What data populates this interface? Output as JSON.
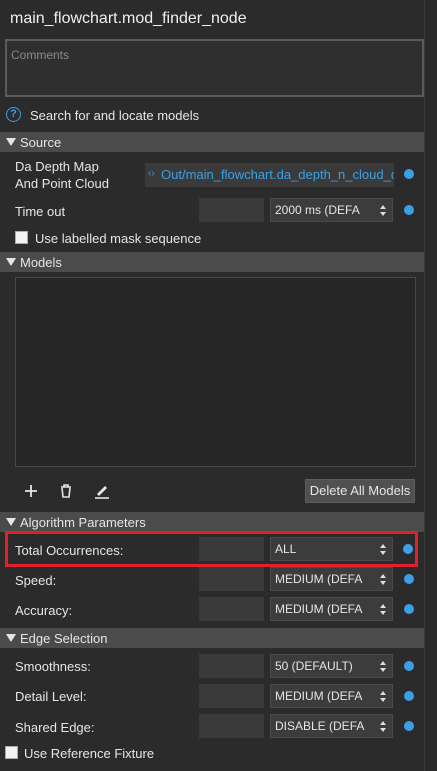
{
  "title": "main_flowchart.mod_finder_node",
  "comments_placeholder": "Comments",
  "help_text": "Search for and locate models",
  "sections": {
    "source": "Source",
    "models": "Models",
    "algorithm": "Algorithm Parameters",
    "edge": "Edge Selection"
  },
  "source": {
    "depth_label_line1": "Da Depth Map",
    "depth_label_line2": "And Point Cloud",
    "depth_value": "Out/main_flowchart.da_depth_n_cloud_co",
    "timeout_label": "Time out",
    "timeout_value": "2000 ms (DEFA",
    "mask_label": "Use labelled mask sequence"
  },
  "models": {
    "delete_all_label": "Delete All Models"
  },
  "algorithm": {
    "total_label": "Total Occurrences:",
    "total_value": "ALL",
    "speed_label": "Speed:",
    "speed_value": "MEDIUM (DEFA",
    "accuracy_label": "Accuracy:",
    "accuracy_value": "MEDIUM (DEFA"
  },
  "edge": {
    "smooth_label": "Smoothness:",
    "smooth_value": "50 (DEFAULT)",
    "detail_label": "Detail Level:",
    "detail_value": "MEDIUM (DEFA",
    "shared_label": "Shared Edge:",
    "shared_value": "DISABLE (DEFA"
  },
  "ref_fixture_label": "Use Reference Fixture",
  "colors": {
    "accent": "#3aa0e6",
    "highlight": "#e0202a"
  }
}
